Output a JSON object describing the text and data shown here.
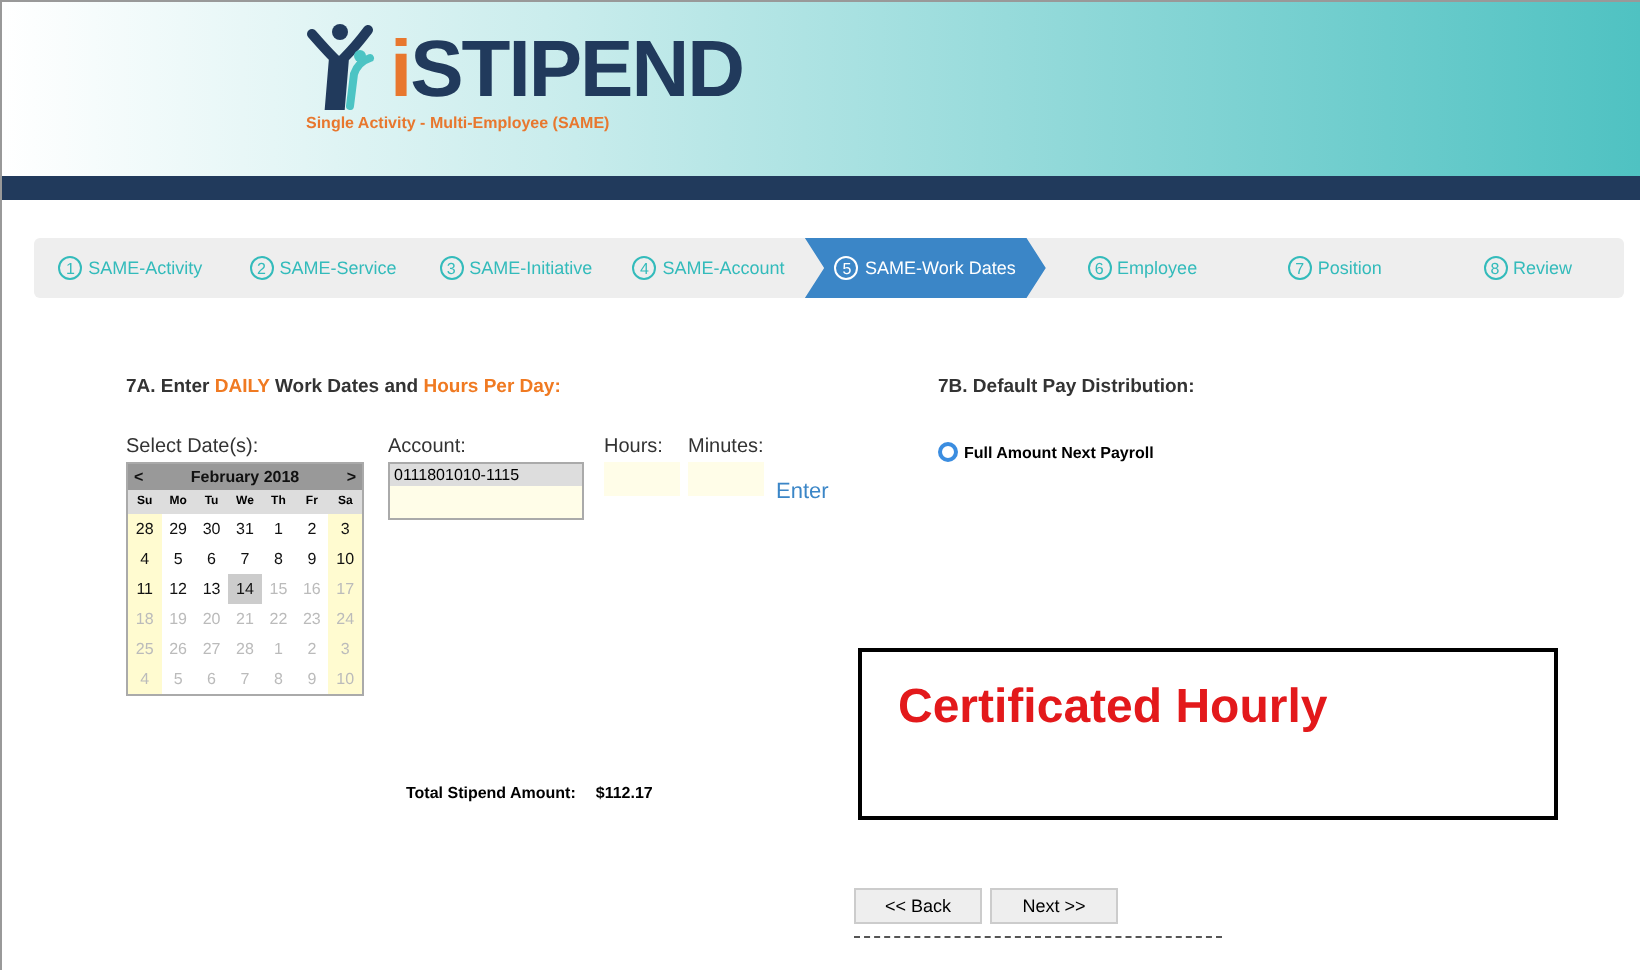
{
  "header": {
    "logo_prefix": "i",
    "logo_name": "STIPEND",
    "subtitle": "Single Activity - Multi-Employee (SAME)"
  },
  "steps": [
    {
      "number": "1",
      "label": "SAME-Activity",
      "selected": false
    },
    {
      "number": "2",
      "label": "SAME-Service",
      "selected": false
    },
    {
      "number": "3",
      "label": "SAME-Initiative",
      "selected": false
    },
    {
      "number": "4",
      "label": "SAME-Account",
      "selected": false
    },
    {
      "number": "5",
      "label": "SAME-Work Dates",
      "selected": true
    },
    {
      "number": "6",
      "label": "Employee",
      "selected": false
    },
    {
      "number": "7",
      "label": "Position",
      "selected": false
    },
    {
      "number": "8",
      "label": "Review",
      "selected": false
    }
  ],
  "section_a": {
    "heading": [
      {
        "text": "7A.  Enter ",
        "highlight": false
      },
      {
        "text": "DAILY",
        "highlight": true
      },
      {
        "text": " Work Dates and ",
        "highlight": false
      },
      {
        "text": "Hours Per Day:",
        "highlight": true
      }
    ],
    "date_label": "Select Date(s):",
    "calendar": {
      "prev": "<",
      "month": "February 2018",
      "next": ">",
      "weekdays": [
        "Su",
        "Mo",
        "Tu",
        "We",
        "Th",
        "Fr",
        "Sa"
      ],
      "weeks": [
        [
          {
            "day": "28",
            "muted": false,
            "selected": false
          },
          {
            "day": "29",
            "muted": false,
            "selected": false
          },
          {
            "day": "30",
            "muted": false,
            "selected": false
          },
          {
            "day": "31",
            "muted": false,
            "selected": false
          },
          {
            "day": "1",
            "muted": false,
            "selected": false
          },
          {
            "day": "2",
            "muted": false,
            "selected": false
          },
          {
            "day": "3",
            "muted": false,
            "selected": false
          }
        ],
        [
          {
            "day": "4",
            "muted": false,
            "selected": false
          },
          {
            "day": "5",
            "muted": false,
            "selected": false
          },
          {
            "day": "6",
            "muted": false,
            "selected": false
          },
          {
            "day": "7",
            "muted": false,
            "selected": false
          },
          {
            "day": "8",
            "muted": false,
            "selected": false
          },
          {
            "day": "9",
            "muted": false,
            "selected": false
          },
          {
            "day": "10",
            "muted": false,
            "selected": false
          }
        ],
        [
          {
            "day": "11",
            "muted": false,
            "selected": false
          },
          {
            "day": "12",
            "muted": false,
            "selected": false
          },
          {
            "day": "13",
            "muted": false,
            "selected": false
          },
          {
            "day": "14",
            "muted": false,
            "selected": true
          },
          {
            "day": "15",
            "muted": true,
            "selected": false
          },
          {
            "day": "16",
            "muted": true,
            "selected": false
          },
          {
            "day": "17",
            "muted": true,
            "selected": false
          }
        ],
        [
          {
            "day": "18",
            "muted": true,
            "selected": false
          },
          {
            "day": "19",
            "muted": true,
            "selected": false
          },
          {
            "day": "20",
            "muted": true,
            "selected": false
          },
          {
            "day": "21",
            "muted": true,
            "selected": false
          },
          {
            "day": "22",
            "muted": true,
            "selected": false
          },
          {
            "day": "23",
            "muted": true,
            "selected": false
          },
          {
            "day": "24",
            "muted": true,
            "selected": false
          }
        ],
        [
          {
            "day": "25",
            "muted": true,
            "selected": false
          },
          {
            "day": "26",
            "muted": true,
            "selected": false
          },
          {
            "day": "27",
            "muted": true,
            "selected": false
          },
          {
            "day": "28",
            "muted": true,
            "selected": false
          },
          {
            "day": "1",
            "muted": true,
            "selected": false
          },
          {
            "day": "2",
            "muted": true,
            "selected": false
          },
          {
            "day": "3",
            "muted": true,
            "selected": false
          }
        ],
        [
          {
            "day": "4",
            "muted": true,
            "selected": false
          },
          {
            "day": "5",
            "muted": true,
            "selected": false
          },
          {
            "day": "6",
            "muted": true,
            "selected": false
          },
          {
            "day": "7",
            "muted": true,
            "selected": false
          },
          {
            "day": "8",
            "muted": true,
            "selected": false
          },
          {
            "day": "9",
            "muted": true,
            "selected": false
          },
          {
            "day": "10",
            "muted": true,
            "selected": false
          }
        ]
      ]
    },
    "account_label": "Account:",
    "account_value": "0111801010-1115",
    "hours_label": "Hours:",
    "minutes_label": "Minutes:",
    "enter_link": "Enter",
    "total_label": "Total Stipend Amount:",
    "total_value": "$112.17"
  },
  "section_b": {
    "heading": "7B.  Default Pay Distribution:",
    "options": [
      {
        "label": "Full Amount Next Payroll",
        "selected": true
      }
    ]
  },
  "annotation": "Certificated Hourly",
  "buttons": [
    "<< Back",
    "Next >>"
  ]
}
